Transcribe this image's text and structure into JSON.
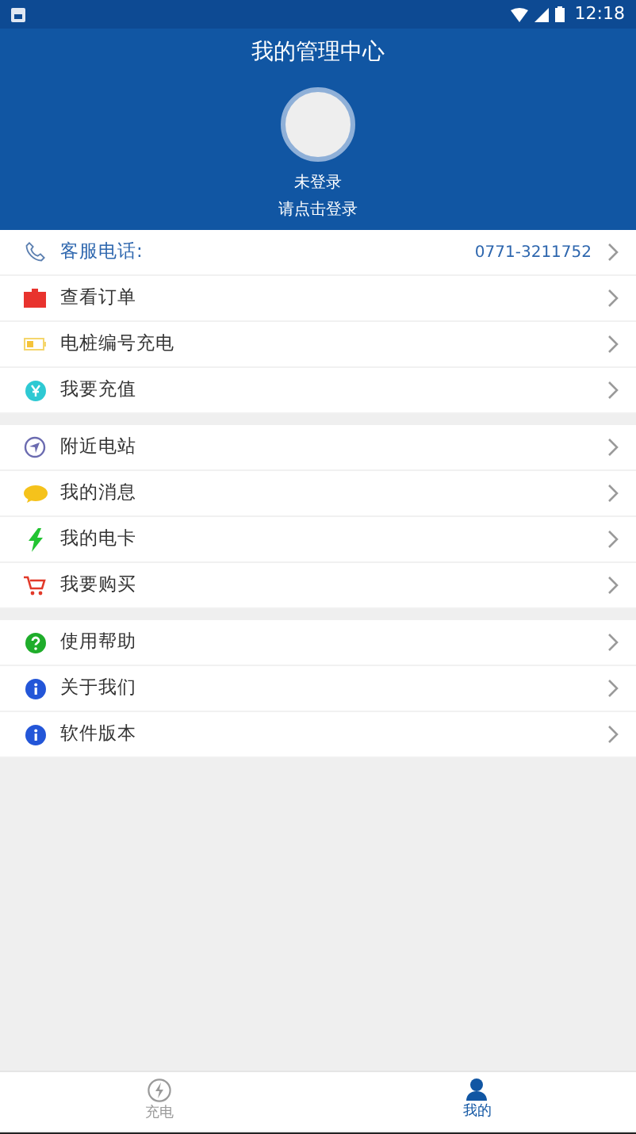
{
  "status_bar": {
    "time": "12:18"
  },
  "header": {
    "title": "我的管理中心",
    "login_status": "未登录",
    "login_hint": "请点击登录"
  },
  "sections": [
    {
      "items": [
        {
          "kind": "contact",
          "label": "客服电话:",
          "value": "0771-3211752"
        },
        {
          "kind": "link",
          "label": "查看订单"
        },
        {
          "kind": "link",
          "label": "电桩编号充电"
        },
        {
          "kind": "link",
          "label": "我要充值"
        }
      ]
    },
    {
      "items": [
        {
          "kind": "link",
          "label": "附近电站"
        },
        {
          "kind": "link",
          "label": "我的消息"
        },
        {
          "kind": "link",
          "label": "我的电卡"
        },
        {
          "kind": "link",
          "label": "我要购买"
        }
      ]
    },
    {
      "items": [
        {
          "kind": "link",
          "label": "使用帮助"
        },
        {
          "kind": "link",
          "label": "关于我们"
        },
        {
          "kind": "link",
          "label": "软件版本"
        }
      ]
    }
  ],
  "tabs": [
    {
      "label": "充电",
      "selected": false
    },
    {
      "label": "我的",
      "selected": true
    }
  ]
}
